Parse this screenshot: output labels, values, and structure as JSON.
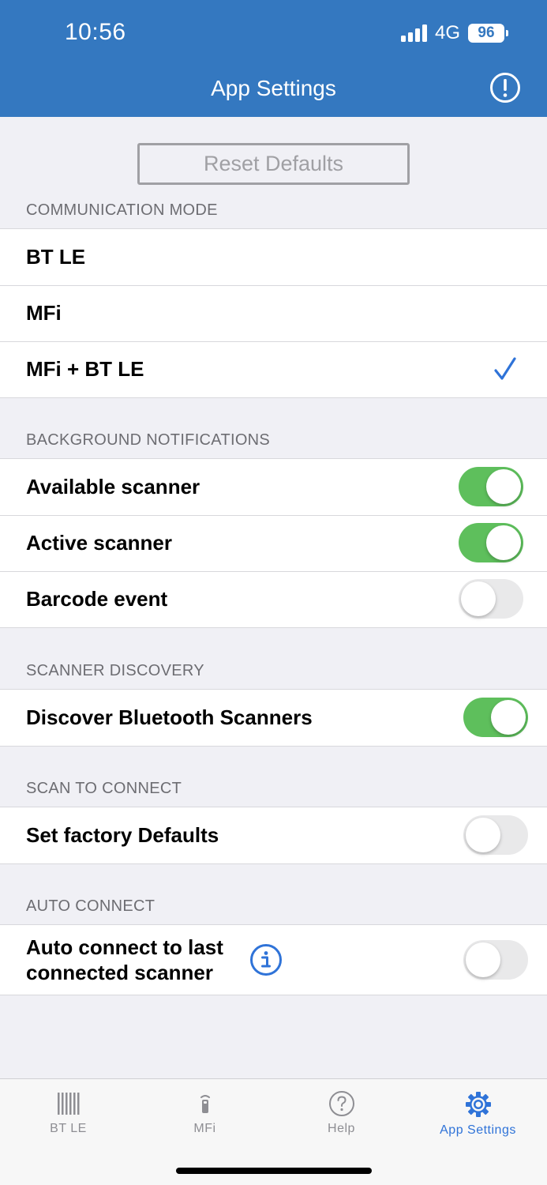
{
  "status": {
    "time": "10:56",
    "network": "4G",
    "battery": "96"
  },
  "nav": {
    "title": "App Settings"
  },
  "reset_button": "Reset Defaults",
  "sections": {
    "communication": {
      "header": "COMMUNICATION MODE",
      "items": [
        {
          "label": "BT LE",
          "selected": false
        },
        {
          "label": "MFi",
          "selected": false
        },
        {
          "label": "MFi + BT LE",
          "selected": true
        }
      ]
    },
    "background": {
      "header": "BACKGROUND NOTIFICATIONS",
      "items": [
        {
          "label": "Available scanner",
          "on": true
        },
        {
          "label": "Active scanner",
          "on": true
        },
        {
          "label": "Barcode event",
          "on": false
        }
      ]
    },
    "discovery": {
      "header": "SCANNER DISCOVERY",
      "items": [
        {
          "label": "Discover Bluetooth Scanners",
          "on": true
        }
      ]
    },
    "scan_to_connect": {
      "header": "SCAN TO CONNECT",
      "items": [
        {
          "label": "Set factory Defaults",
          "on": false
        }
      ]
    },
    "auto_connect": {
      "header": "AUTO CONNECT",
      "items": [
        {
          "label_line1": "Auto connect to last",
          "label_line2": "connected scanner",
          "on": false
        }
      ]
    }
  },
  "tabs": [
    {
      "label": "BT LE",
      "icon": "barcode-icon",
      "active": false
    },
    {
      "label": "MFi",
      "icon": "scanner-device-icon",
      "active": false
    },
    {
      "label": "Help",
      "icon": "help-icon",
      "active": false
    },
    {
      "label": "App Settings",
      "icon": "gear-icon",
      "active": true
    }
  ],
  "colors": {
    "nav_bar": "#3478c0",
    "toggle_on": "#5ebf5c",
    "accent": "#2f73d8",
    "background": "#f0f0f5"
  }
}
